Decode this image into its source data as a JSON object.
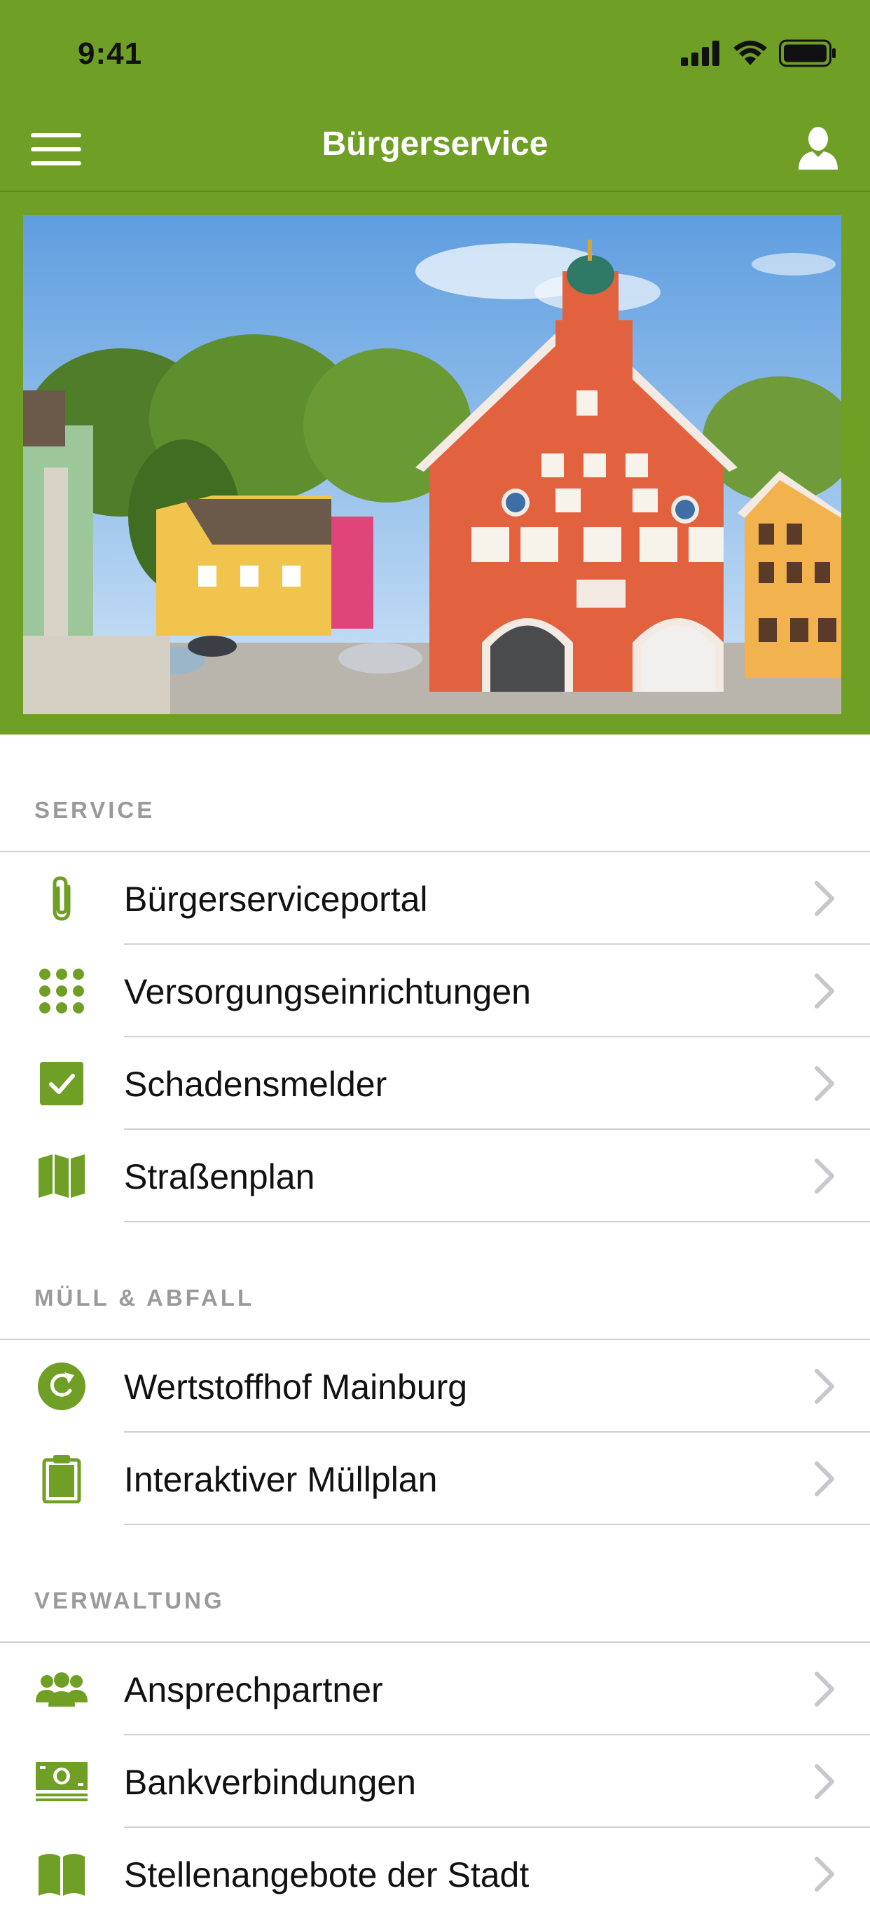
{
  "status_bar": {
    "time": "9:41"
  },
  "navbar": {
    "title": "Bürgerservice"
  },
  "colors": {
    "accent": "#6f9f24",
    "section_text": "#9a9a9a",
    "separator": "#cfcfcf",
    "chevron": "#c7c7cc"
  },
  "sections": [
    {
      "title": "SERVICE",
      "items": [
        {
          "label": "Bürgerserviceportal",
          "icon": "paperclip-icon"
        },
        {
          "label": "Versorgungseinrichtungen",
          "icon": "grid-dots-icon"
        },
        {
          "label": "Schadensmelder",
          "icon": "checkbox-icon"
        },
        {
          "label": "Straßenplan",
          "icon": "map-icon"
        }
      ]
    },
    {
      "title": "MÜLL & ABFALL",
      "items": [
        {
          "label": "Wertstoffhof Mainburg",
          "icon": "recycle-refresh-icon"
        },
        {
          "label": "Interaktiver Müllplan",
          "icon": "clipboard-icon"
        }
      ]
    },
    {
      "title": "VERWALTUNG",
      "items": [
        {
          "label": "Ansprechpartner",
          "icon": "people-icon"
        },
        {
          "label": "Bankverbindungen",
          "icon": "banknote-icon"
        },
        {
          "label": "Stellenangebote der Stadt",
          "icon": "book-icon"
        }
      ]
    }
  ]
}
